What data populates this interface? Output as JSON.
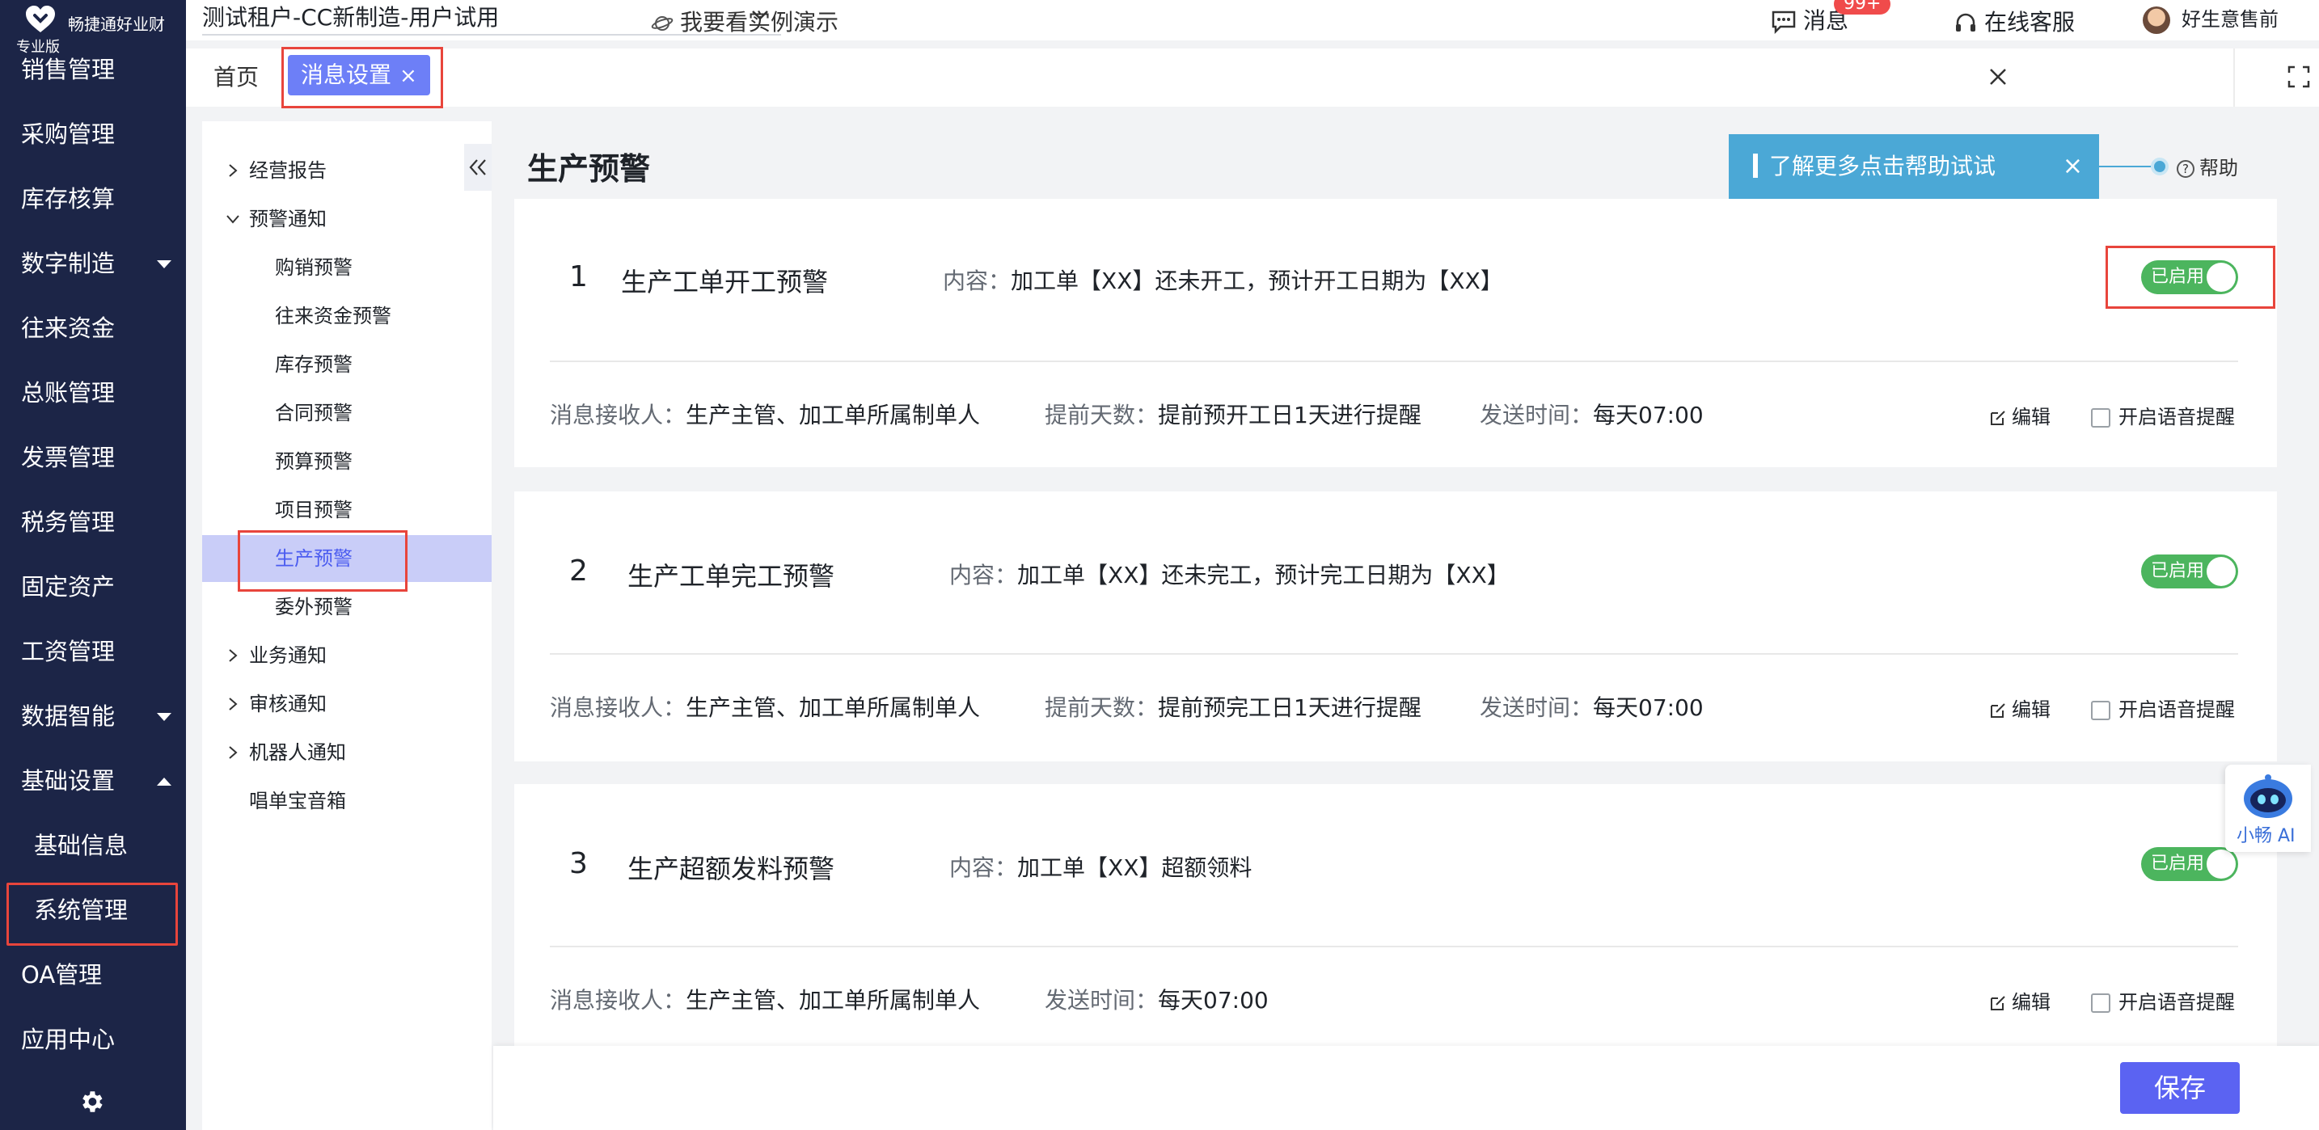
{
  "brand": {
    "name": "畅捷通好业财",
    "edition": "专业版",
    "accent": "#1c2547"
  },
  "sidebar": {
    "items": [
      {
        "label": "销售管理"
      },
      {
        "label": "采购管理"
      },
      {
        "label": "库存核算"
      },
      {
        "label": "数字制造",
        "caret": "down"
      },
      {
        "label": "往来资金"
      },
      {
        "label": "总账管理"
      },
      {
        "label": "发票管理"
      },
      {
        "label": "税务管理"
      },
      {
        "label": "固定资产"
      },
      {
        "label": "工资管理"
      },
      {
        "label": "数据智能",
        "caret": "down"
      },
      {
        "label": "基础设置",
        "caret": "up"
      },
      {
        "label": "基础信息",
        "sub": true
      },
      {
        "label": "系统管理",
        "sub": true,
        "highlighted": true
      },
      {
        "label": "OA管理"
      },
      {
        "label": "应用中心"
      }
    ],
    "settings_icon": "gear-icon"
  },
  "header": {
    "tenant": "测试租户-CC新制造-用户试用",
    "demo": "我要看实例演示",
    "messages": "消息",
    "messages_badge": "99+",
    "service": "在线客服",
    "user": "好生意售前"
  },
  "tabs": {
    "home": "首页",
    "active": "消息设置",
    "active_close": "×"
  },
  "tree": {
    "items": [
      {
        "label": "经营报告",
        "level": 1,
        "arrow": "right"
      },
      {
        "label": "预警通知",
        "level": 1,
        "arrow": "down"
      },
      {
        "label": "购销预警",
        "level": 2
      },
      {
        "label": "往来资金预警",
        "level": 2
      },
      {
        "label": "库存预警",
        "level": 2
      },
      {
        "label": "合同预警",
        "level": 2
      },
      {
        "label": "预算预警",
        "level": 2
      },
      {
        "label": "项目预警",
        "level": 2
      },
      {
        "label": "生产预警",
        "level": 2,
        "active": true
      },
      {
        "label": "委外预警",
        "level": 2
      },
      {
        "label": "业务通知",
        "level": 1,
        "arrow": "right"
      },
      {
        "label": "审核通知",
        "level": 1,
        "arrow": "right"
      },
      {
        "label": "机器人通知",
        "level": 1,
        "arrow": "right"
      },
      {
        "label": "唱单宝音箱",
        "level": 1
      }
    ]
  },
  "page": {
    "title": "生产预警",
    "tip": "了解更多点击帮助试试",
    "tip_close": "×",
    "help": "帮助",
    "help_q": "?"
  },
  "cards": [
    {
      "num": "1",
      "title": "生产工单开工预警",
      "content_label": "内容：",
      "content": "加工单【XX】还未开工，预计开工日期为【XX】",
      "switch": "已启用",
      "enabled": true,
      "recipients_label": "消息接收人：",
      "recipients": "生产主管、加工单所属制单人",
      "advance_label": "提前天数：",
      "advance": "提前预开工日1天进行提醒",
      "send_label": "发送时间：",
      "send": "每天07:00",
      "edit": "编辑",
      "voice": "开启语音提醒",
      "voice_checked": false
    },
    {
      "num": "2",
      "title": "生产工单完工预警",
      "content_label": "内容：",
      "content": "加工单【XX】还未完工，预计完工日期为【XX】",
      "switch": "已启用",
      "enabled": true,
      "recipients_label": "消息接收人：",
      "recipients": "生产主管、加工单所属制单人",
      "advance_label": "提前天数：",
      "advance": "提前预完工日1天进行提醒",
      "send_label": "发送时间：",
      "send": "每天07:00",
      "edit": "编辑",
      "voice": "开启语音提醒",
      "voice_checked": false
    },
    {
      "num": "3",
      "title": "生产超额发料预警",
      "content_label": "内容：",
      "content": "加工单【XX】超额领料",
      "switch": "已启用",
      "enabled": true,
      "recipients_label": "消息接收人：",
      "recipients": "生产主管、加工单所属制单人",
      "send_label": "发送时间：",
      "send": "每天07:00",
      "edit": "编辑",
      "voice": "开启语音提醒",
      "voice_checked": false
    }
  ],
  "footer": {
    "save": "保存"
  },
  "assistant": {
    "label": "小畅 AI"
  },
  "colors": {
    "sidebar_bg": "#1c2547",
    "active_tab": "#6d7ff7",
    "switch_on": "#4cb55e",
    "tip_bg": "#4ba8d6",
    "save_button": "#5b63f2",
    "highlight_outline": "#e8453c",
    "tree_active_bg": "#c9cdf8"
  }
}
